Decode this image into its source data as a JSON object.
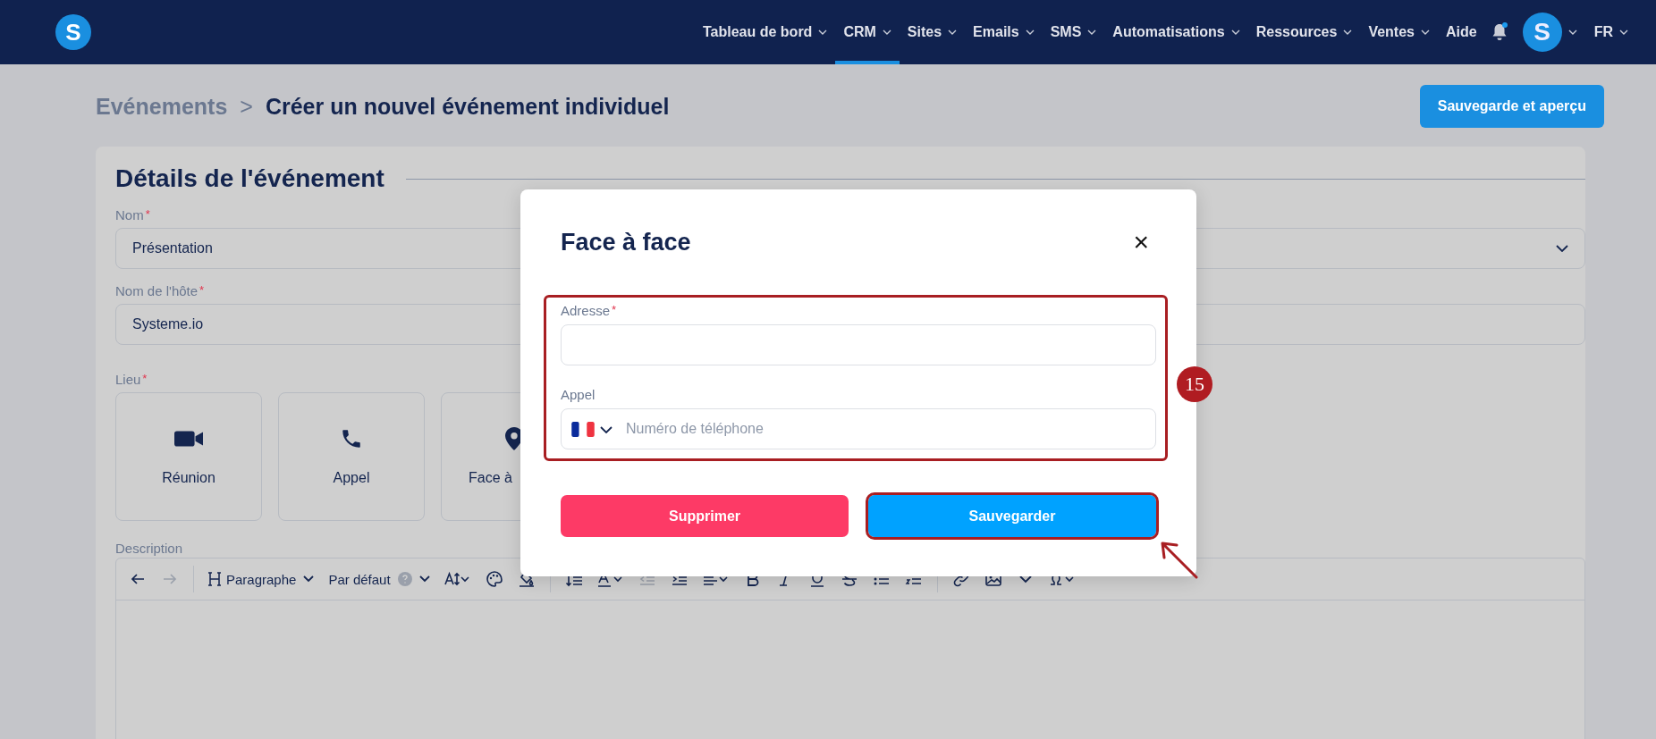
{
  "nav": {
    "logo": "S",
    "items": [
      {
        "label": "Tableau de bord",
        "dropdown": true,
        "selected": false
      },
      {
        "label": "CRM",
        "dropdown": true,
        "selected": true
      },
      {
        "label": "Sites",
        "dropdown": true,
        "selected": false
      },
      {
        "label": "Emails",
        "dropdown": true,
        "selected": false
      },
      {
        "label": "SMS",
        "dropdown": true,
        "selected": false
      },
      {
        "label": "Automatisations",
        "dropdown": true,
        "selected": false
      },
      {
        "label": "Ressources",
        "dropdown": true,
        "selected": false
      },
      {
        "label": "Ventes",
        "dropdown": true,
        "selected": false
      },
      {
        "label": "Aide",
        "dropdown": false,
        "selected": false
      }
    ],
    "notification_dot": true,
    "avatar": "S",
    "language": "FR"
  },
  "breadcrumb": {
    "parent": "Evénements",
    "separator": ">",
    "current": "Créer un nouvel événement individuel"
  },
  "preview_button": "Sauvegarde et aperçu",
  "card": {
    "title": "Détails de l'événement",
    "fields": [
      {
        "label": "Nom",
        "required_mark": "*",
        "value": "Présentation",
        "dropdown": true
      },
      {
        "label": "Nom de l'hôte",
        "required_mark": "*",
        "value": "Systeme.io",
        "dropdown": false
      }
    ],
    "location": {
      "label": "Lieu",
      "required_mark": "*",
      "options": [
        {
          "label": "Réunion"
        },
        {
          "label": "Appel"
        },
        {
          "label": "Face à"
        }
      ]
    },
    "description": {
      "label": "Description",
      "toolbar": {
        "heading": "Paragraphe",
        "font": "Par défaut",
        "redo_disabled": true,
        "outdent_disabled": true
      }
    }
  },
  "modal": {
    "title": "Face à face",
    "close": "×",
    "address": {
      "label": "Adresse",
      "required_mark": "*"
    },
    "phone": {
      "label": "Appel",
      "placeholder": "Numéro de téléphone"
    },
    "delete_button": "Supprimer",
    "save_button": "Sauvegarder"
  },
  "annotation": {
    "badge": "15"
  }
}
